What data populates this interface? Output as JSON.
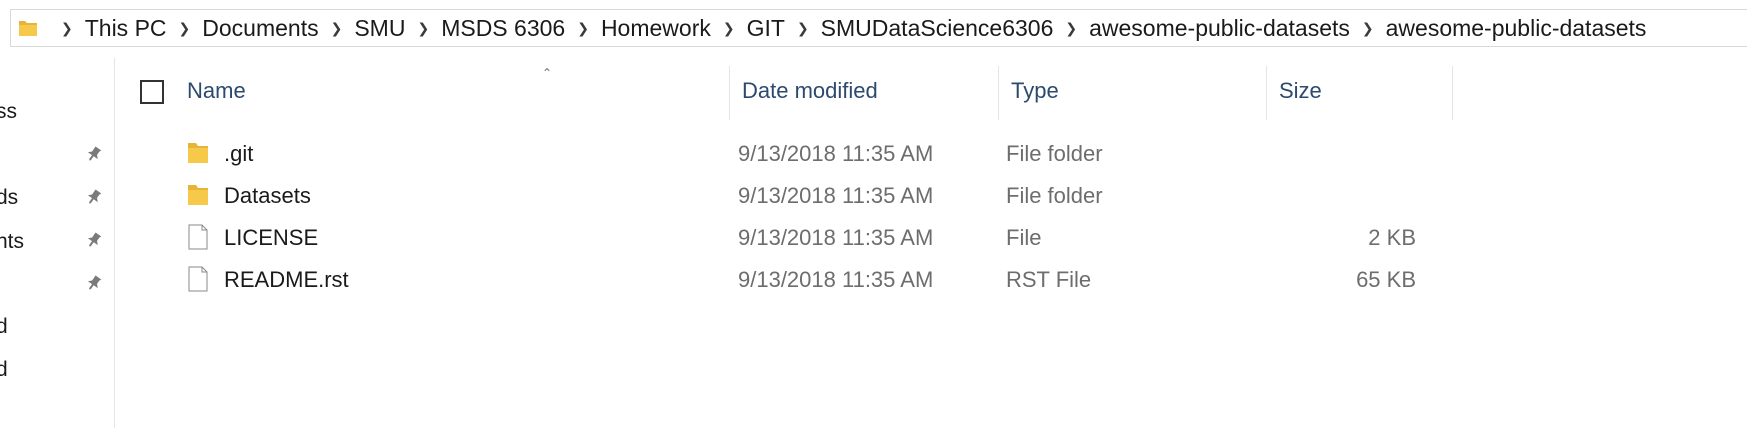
{
  "breadcrumb": {
    "folder_icon": "folder-icon",
    "items": [
      "This PC",
      "Documents",
      "SMU",
      "MSDS 6306",
      "Homework",
      "GIT",
      "SMUDataScience6306",
      "awesome-public-datasets",
      "awesome-public-datasets"
    ]
  },
  "nav": {
    "items": [
      "ss",
      "ds",
      "nts",
      "d",
      "d"
    ],
    "pin_icon": "pin-icon"
  },
  "columns": {
    "name": "Name",
    "date": "Date modified",
    "type": "Type",
    "size": "Size"
  },
  "files": [
    {
      "icon": "folder-icon",
      "name": ".git",
      "date": "9/13/2018 11:35 AM",
      "type": "File folder",
      "size": ""
    },
    {
      "icon": "folder-icon",
      "name": "Datasets",
      "date": "9/13/2018 11:35 AM",
      "type": "File folder",
      "size": ""
    },
    {
      "icon": "file-icon",
      "name": "LICENSE",
      "date": "9/13/2018 11:35 AM",
      "type": "File",
      "size": "2 KB"
    },
    {
      "icon": "file-icon",
      "name": "README.rst",
      "date": "9/13/2018 11:35 AM",
      "type": "RST File",
      "size": "65 KB"
    }
  ],
  "colors": {
    "header_text": "#2c4a6e",
    "folder_yellow": "#f7c94b"
  }
}
